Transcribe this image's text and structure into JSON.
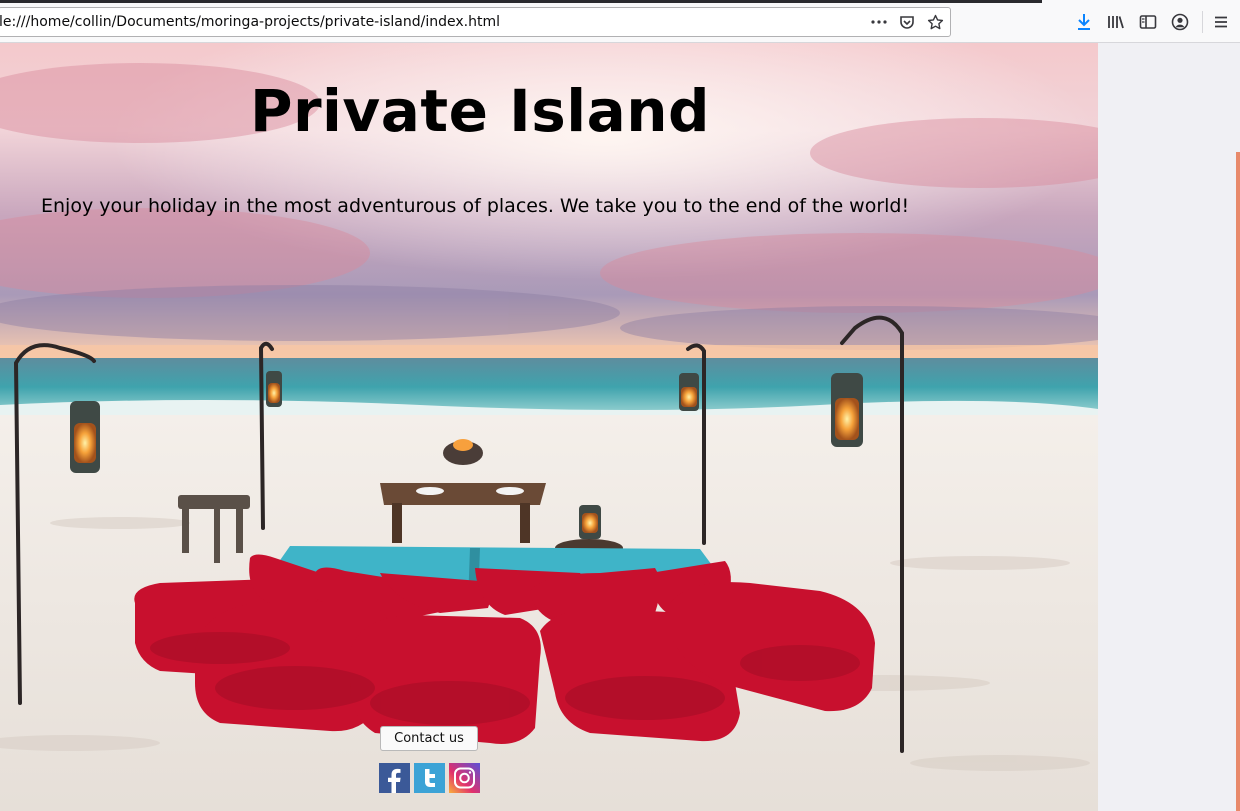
{
  "browser": {
    "url": "le:///home/collin/Documents/moringa-projects/private-island/index.html",
    "url_actions": [
      {
        "name": "page-actions-icon",
        "glyph": "•••"
      },
      {
        "name": "pocket-icon"
      },
      {
        "name": "bookmark-star-icon"
      }
    ],
    "toolbar_icons": [
      "download-icon",
      "library-icon",
      "sidebar-icon",
      "account-icon",
      "menu-icon"
    ]
  },
  "page": {
    "title": "Private Island",
    "tagline": "Enjoy your holiday in the most adventurous of places. We take you to the end of the world!",
    "contact_button": "Contact us",
    "social": [
      "facebook-icon",
      "twitter-icon",
      "instagram-icon"
    ]
  },
  "colors": {
    "scroll_accent": "#e8896a",
    "cushion_red": "#c8102e",
    "blanket_teal": "#3fb4c8"
  }
}
